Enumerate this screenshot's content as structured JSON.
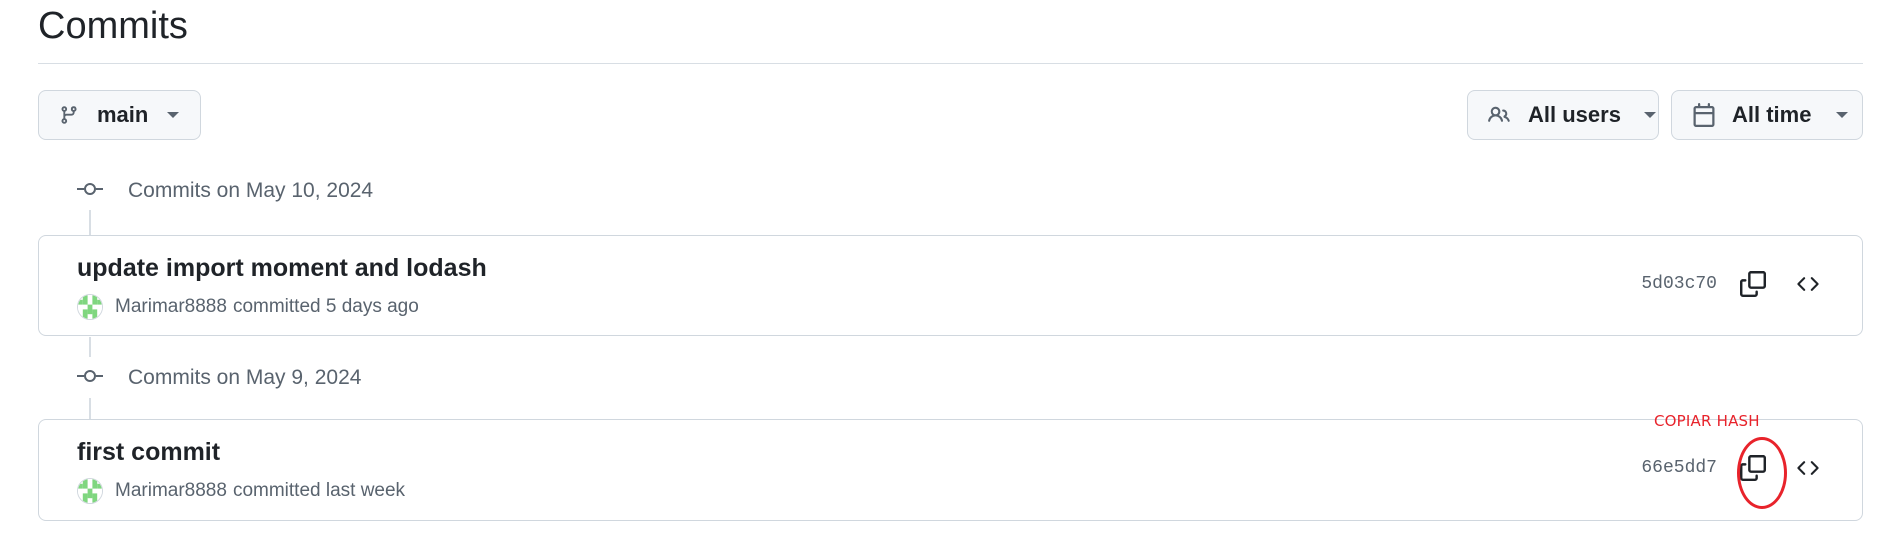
{
  "page": {
    "title": "Commits"
  },
  "toolbar": {
    "branch_label": "main",
    "users_label": "All users",
    "time_label": "All time"
  },
  "groups": [
    {
      "heading": "Commits on May 10, 2024",
      "commits": [
        {
          "message": "update import moment and lodash",
          "author": "Marimar8888",
          "action_time": "committed 5 days ago",
          "sha": "5d03c70"
        }
      ]
    },
    {
      "heading": "Commits on May 9, 2024",
      "commits": [
        {
          "message": "first commit",
          "author": "Marimar8888",
          "action_time": "committed last week",
          "sha": "66e5dd7"
        }
      ]
    }
  ],
  "annotation": {
    "label": "COPIAR HASH",
    "color": "#e8232b"
  },
  "icons": {
    "branch": "git-branch-icon",
    "users": "people-icon",
    "time": "calendar-icon",
    "caret": "triangle-down-icon",
    "group": "git-commit-icon",
    "copy": "copy-icon",
    "browse": "code-icon"
  },
  "colors": {
    "border": "#d0d7de",
    "muted_text": "#59636e",
    "button_bg": "#f6f8fa"
  }
}
